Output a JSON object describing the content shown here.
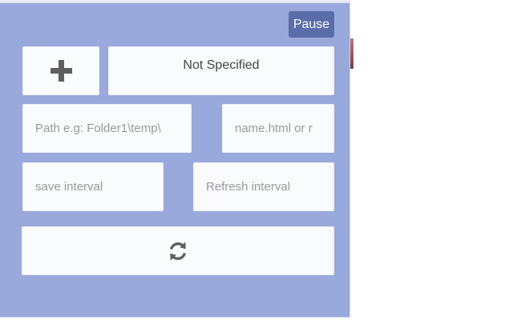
{
  "toolbar": {
    "pause_label": "Pause"
  },
  "folder": {
    "add_icon": "plus-icon",
    "selected": "Not Specified"
  },
  "fields": {
    "path_placeholder": "Path e.g: Folder1\\temp\\",
    "filename_placeholder": "name.html or r",
    "save_interval_placeholder": "save interval",
    "refresh_interval_placeholder": "Refresh interval"
  },
  "actions": {
    "sync_icon": "sync-icon"
  },
  "colors": {
    "panel_background": "#9aa9dc",
    "pause_button": "#5a6da8",
    "field_background": "#fafbfd",
    "icon_gray": "#5f5f5f"
  }
}
